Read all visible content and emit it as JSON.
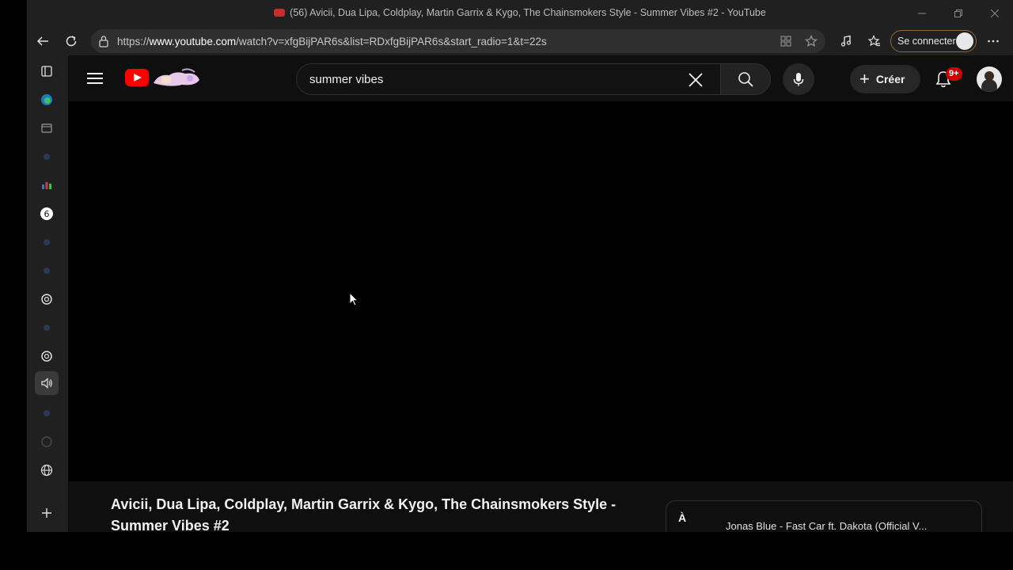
{
  "window": {
    "title": "(56) Avicii, Dua Lipa, Coldplay, Martin Garrix & Kygo, The Chainsmokers Style - Summer Vibes #2 - YouTube",
    "controls": [
      "minimize",
      "restore",
      "close"
    ]
  },
  "toolbar": {
    "url_prefix": "https://",
    "url_host": "www.youtube.com",
    "url_rest": "/watch?v=xfgBijPAR6s&list=RDxfgBijPAR6s&start_radio=1&t=22s",
    "signin_label": "Se connecter"
  },
  "youtube": {
    "search": {
      "value": "summer vibes"
    },
    "create_label": "Créer",
    "notifications_badge": "9+",
    "video_title": "Avicii, Dua Lipa, Coldplay, Martin Garrix & Kygo, The Chainsmokers Style - Summer Vibes #2",
    "up_next": {
      "label": "À",
      "title": "Jonas Blue - Fast Car ft. Dakota (Official V..."
    }
  },
  "colors": {
    "brand": "#ff0000",
    "badge": "#cc0000",
    "background": "#0f0f0f"
  }
}
